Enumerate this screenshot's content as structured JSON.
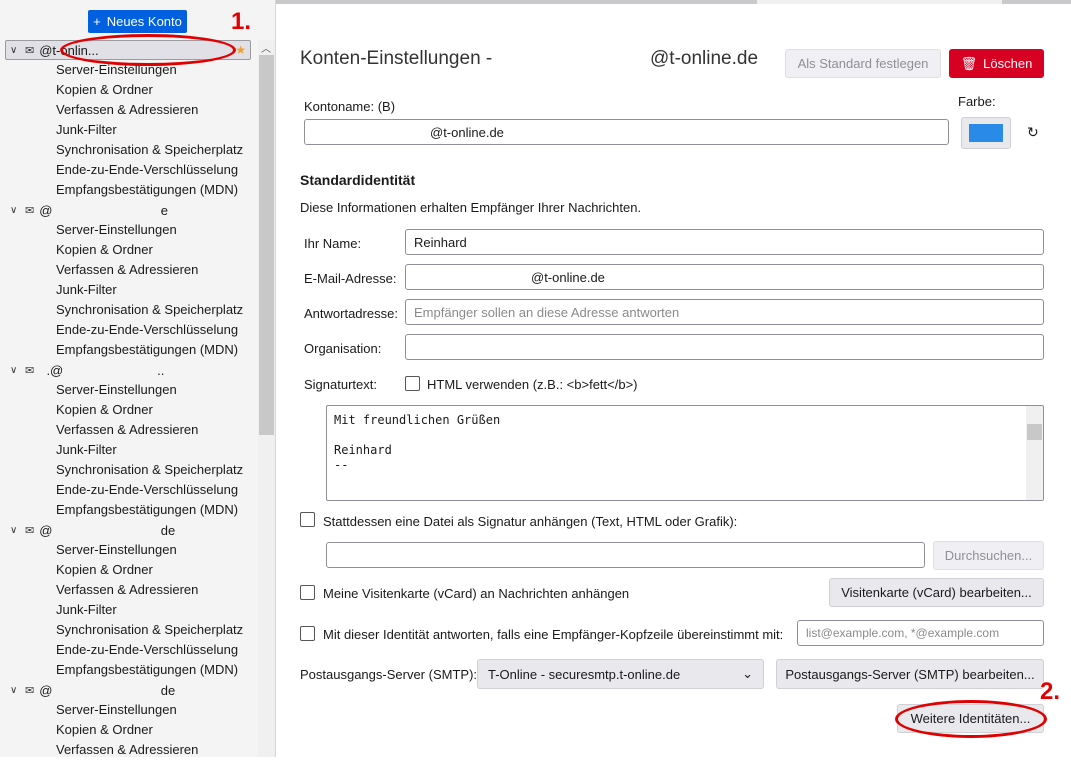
{
  "sidebar": {
    "new_account": "Neues Konto",
    "accounts": [
      {
        "label": "@t-onlin...",
        "items": [
          "Server-Einstellungen",
          "Kopien & Ordner",
          "Verfassen & Adressieren",
          "Junk-Filter",
          "Synchronisation & Speicherplatz",
          "Ende-zu-Ende-Verschlüsselung",
          "Empfangsbestätigungen (MDN)"
        ]
      },
      {
        "label": "@                              e",
        "items": [
          "Server-Einstellungen",
          "Kopien & Ordner",
          "Verfassen & Adressieren",
          "Junk-Filter",
          "Synchronisation & Speicherplatz",
          "Ende-zu-Ende-Verschlüsselung",
          "Empfangsbestätigungen (MDN)"
        ]
      },
      {
        "label": "  .@                          ..",
        "items": [
          "Server-Einstellungen",
          "Kopien & Ordner",
          "Verfassen & Adressieren",
          "Junk-Filter",
          "Synchronisation & Speicherplatz",
          "Ende-zu-Ende-Verschlüsselung",
          "Empfangsbestätigungen (MDN)"
        ]
      },
      {
        "label": "@                              de",
        "items": [
          "Server-Einstellungen",
          "Kopien & Ordner",
          "Verfassen & Adressieren",
          "Junk-Filter",
          "Synchronisation & Speicherplatz",
          "Ende-zu-Ende-Verschlüsselung",
          "Empfangsbestätigungen (MDN)"
        ]
      },
      {
        "label": "@                              de",
        "items": [
          "Server-Einstellungen",
          "Kopien & Ordner",
          "Verfassen & Adressieren"
        ]
      }
    ]
  },
  "header": {
    "title": "Konten-Einstellungen -",
    "title_domain": "@t-online.de",
    "set_default": "Als Standard festlegen",
    "delete": "Löschen"
  },
  "account_name": {
    "label": "Kontoname: (B)",
    "value": "@t-online.de",
    "color_label": "Farbe:",
    "color": "#2a8ae8"
  },
  "identity": {
    "heading": "Standardidentität",
    "description": "Diese Informationen erhalten Empfänger Ihrer Nachrichten.",
    "name_label": "Ihr Name:",
    "name_value": "Reinhard",
    "email_label": "E-Mail-Adresse:",
    "email_value": "@t-online.de",
    "reply_label": "Antwortadresse:",
    "reply_placeholder": "Empfänger sollen an diese Adresse antworten",
    "org_label": "Organisation:",
    "sig_label": "Signaturtext:",
    "html_label": "HTML verwenden (z.B.: <b>fett</b>)",
    "signature": "Mit freundlichen Grüßen\n\nReinhard\n--",
    "sigfile_label": "Stattdessen eine Datei als Signatur anhängen (Text, HTML oder Grafik):",
    "browse": "Durchsuchen...",
    "vcard_label": "Meine Visitenkarte (vCard) an Nachrichten anhängen",
    "vcard_edit": "Visitenkarte (vCard) bearbeiten...",
    "reply_match_label": "Mit dieser Identität antworten, falls eine Empfänger-Kopfzeile übereinstimmt mit:",
    "reply_match_placeholder": "list@example.com, *@example.com",
    "smtp_label": "Postausgangs-Server (SMTP):",
    "smtp_value": "T-Online - securesmtp.t-online.de",
    "smtp_edit": "Postausgangs-Server (SMTP) bearbeiten...",
    "more_identities": "Weitere Identitäten..."
  },
  "annotations": {
    "one": "1.",
    "two": "2."
  }
}
